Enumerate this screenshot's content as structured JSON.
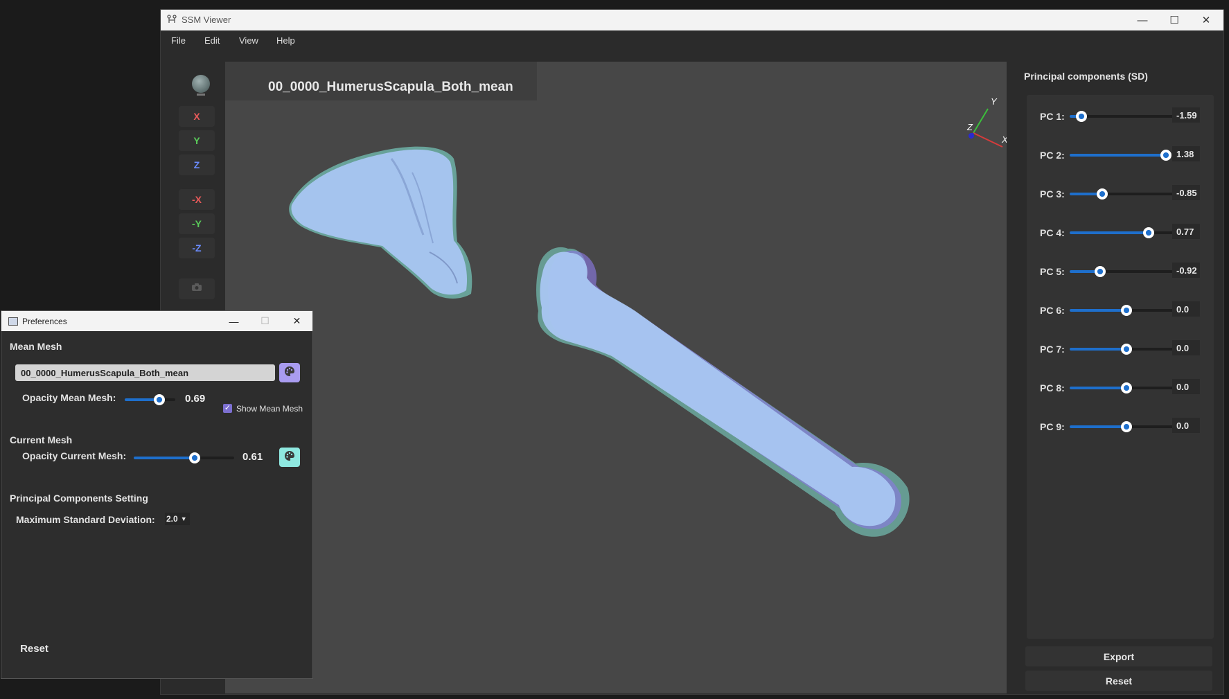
{
  "window": {
    "title": "SSM Viewer",
    "minimize": "—",
    "maximize": "☐",
    "close": "✕"
  },
  "menu": {
    "file": "File",
    "edit": "Edit",
    "view": "View",
    "help": "Help"
  },
  "toolbar": {
    "x": "X",
    "y": "Y",
    "z": "Z",
    "neg_x": "-X",
    "neg_y": "-Y",
    "neg_z": "-Z",
    "colors": {
      "x": "#e85a5a",
      "y": "#5acb5a",
      "z": "#6b8cff"
    }
  },
  "viewport": {
    "mesh_title": "00_0000_HumerusScapula_Both_mean",
    "axes": {
      "x": "X",
      "y": "Y",
      "z": "Z"
    }
  },
  "pc_panel": {
    "heading": "Principal components (SD)",
    "max_sd": 2.0,
    "rows": [
      {
        "label": "PC 1:",
        "value": "-1.59"
      },
      {
        "label": "PC 2:",
        "value": "1.38"
      },
      {
        "label": "PC 3:",
        "value": "-0.85"
      },
      {
        "label": "PC 4:",
        "value": "0.77"
      },
      {
        "label": "PC 5:",
        "value": "-0.92"
      },
      {
        "label": "PC 6:",
        "value": "0.0"
      },
      {
        "label": "PC 7:",
        "value": "0.0"
      },
      {
        "label": "PC 8:",
        "value": "0.0"
      },
      {
        "label": "PC 9:",
        "value": "0.0"
      }
    ],
    "export": "Export",
    "reset": "Reset"
  },
  "prefs": {
    "title": "Preferences",
    "minimize": "—",
    "maximize": "☐",
    "close": "✕",
    "mean_mesh_heading": "Mean Mesh",
    "mean_mesh_name": "00_0000_HumerusScapula_Both_mean",
    "opacity_mean_label": "Opacity Mean Mesh:",
    "opacity_mean_value": "0.69",
    "opacity_mean": 0.69,
    "show_mean_label": "Show Mean Mesh",
    "show_mean_checked": true,
    "current_mesh_heading": "Current Mesh",
    "opacity_current_label": "Opacity Current Mesh:",
    "opacity_current_value": "0.61",
    "opacity_current": 0.61,
    "pc_setting_heading": "Principal Components Setting",
    "max_sd_label": "Maximum Standard Deviation:",
    "max_sd_value": "2.0",
    "reset": "Reset",
    "mean_palette_color": "#a99cf0",
    "current_palette_color": "#8fe8e0"
  },
  "colors": {
    "accent": "#1e6fcc",
    "scapula": "#a9c6f2",
    "humerus": "#a9c6f2",
    "mean_mesh": "#8b7ae0",
    "current_mesh": "#7fe0d0"
  }
}
